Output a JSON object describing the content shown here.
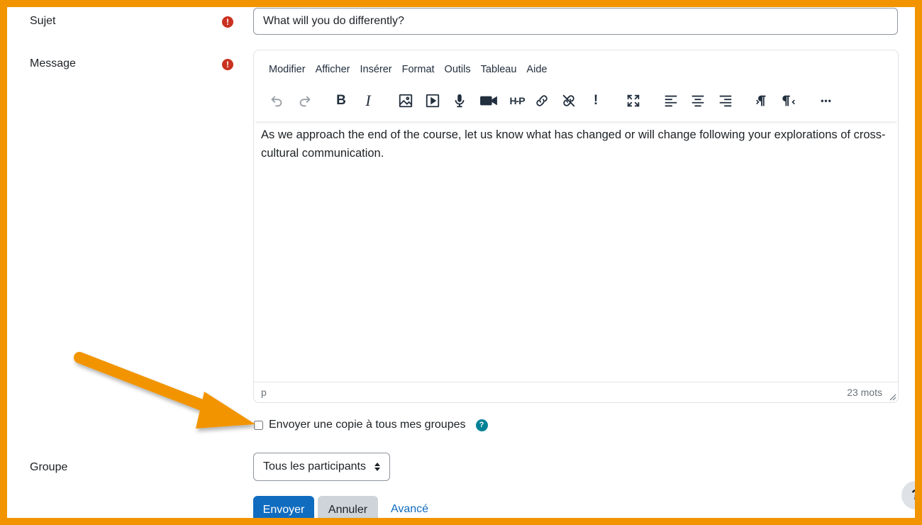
{
  "form": {
    "subject_label": "Sujet",
    "subject_value": "What will you do differently?",
    "message_label": "Message",
    "required_glyph": "!",
    "group_label": "Groupe"
  },
  "editor": {
    "menu": [
      "Modifier",
      "Afficher",
      "Insérer",
      "Format",
      "Outils",
      "Tableau",
      "Aide"
    ],
    "toolbar_text": {
      "bold": "B",
      "italic": "I",
      "h5p": "H-P",
      "accessibility": "!",
      "more": "•••"
    },
    "content": "As we approach the end of the course, let us know what has changed or will change following your explorations of cross-cultural communication.",
    "status_path": "p",
    "word_count": "23 mots"
  },
  "options": {
    "copy_label": "Envoyer une copie à tous mes groupes",
    "help_glyph": "?"
  },
  "group_select": {
    "selected": "Tous les participants"
  },
  "actions": {
    "submit": "Envoyer",
    "cancel": "Annuler",
    "advanced": "Avancé"
  },
  "floating_help_glyph": "?",
  "colors": {
    "frame": "#f29400",
    "primary": "#0f6cbf",
    "required": "#ca3120",
    "help": "#008196",
    "arrow": "#f29400"
  },
  "icons": [
    "undo-icon",
    "redo-icon",
    "image-icon",
    "media-icon",
    "microphone-icon",
    "video-camera-icon",
    "link-icon",
    "unlink-icon",
    "fullscreen-icon",
    "align-left-icon",
    "align-center-icon",
    "align-right-icon",
    "ltr-icon",
    "rtl-icon"
  ]
}
